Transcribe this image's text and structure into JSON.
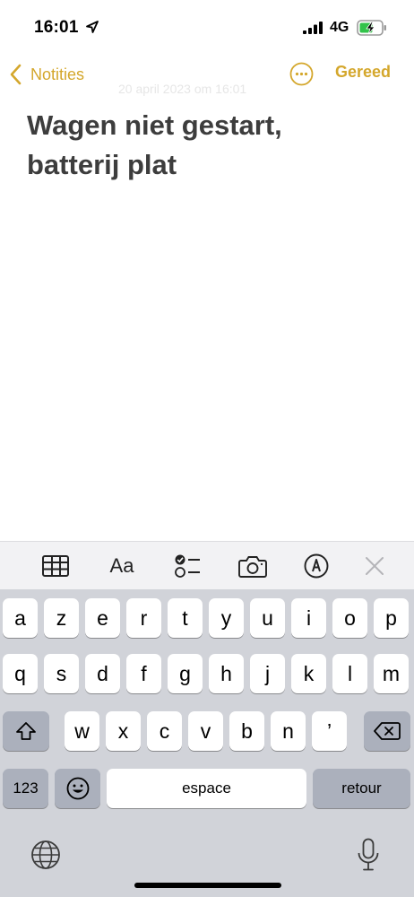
{
  "status_bar": {
    "time": "16:01",
    "network": "4G",
    "icons": [
      "location-arrow-icon",
      "signal-icon",
      "battery-charging-icon"
    ]
  },
  "nav": {
    "back_label": "Notities",
    "done_label": "Gereed",
    "date_text": "20 april 2023 om 16:01",
    "accent_color": "#d4a72c"
  },
  "note": {
    "title_line1": "Wagen niet gestart,",
    "title_line2": "batterij plat"
  },
  "toolbar": {
    "format_label": "Aa",
    "icons": [
      "table-icon",
      "format-icon",
      "checklist-icon",
      "camera-icon",
      "markup-icon",
      "close-icon"
    ]
  },
  "keyboard": {
    "row1": [
      "a",
      "z",
      "e",
      "r",
      "t",
      "y",
      "u",
      "i",
      "o",
      "p"
    ],
    "row2": [
      "q",
      "s",
      "d",
      "f",
      "g",
      "h",
      "j",
      "k",
      "l",
      "m"
    ],
    "row3": [
      "w",
      "x",
      "c",
      "v",
      "b",
      "n",
      "’"
    ],
    "numbers_label": "123",
    "space_label": "espace",
    "return_label": "retour",
    "icons": [
      "shift-icon",
      "backspace-icon",
      "emoji-icon",
      "globe-icon",
      "microphone-icon"
    ]
  }
}
